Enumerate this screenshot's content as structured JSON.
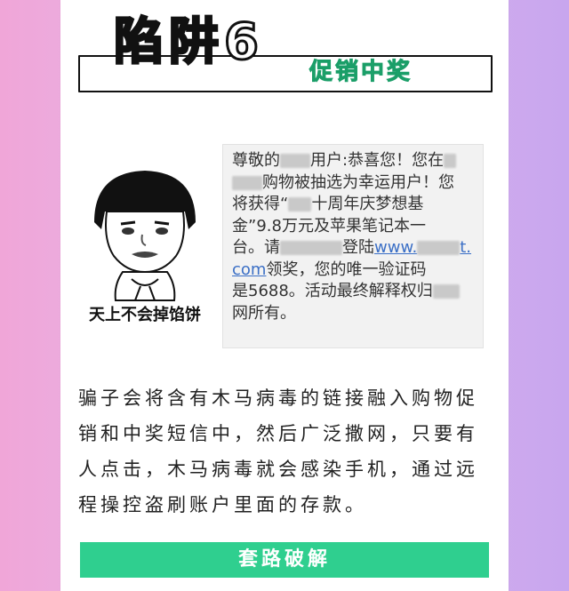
{
  "header": {
    "title": "陷阱6",
    "subtitle": "促销中奖"
  },
  "meme": {
    "caption": "天上不会掉馅饼",
    "icon": "mushroom-hair-meme-face"
  },
  "sms": {
    "line1_a": "尊敬的",
    "line1_b": "用户:恭喜您！您在",
    "line2": "购物被抽选为幸运用户！您",
    "line3_a": "将获得“",
    "line3_b": "十周年庆梦想基",
    "line4": "金”9.8万元及苹果笔记本一",
    "line5_a": "台。请",
    "line5_b": "登陆",
    "link_a": "www.",
    "link_b": "t.",
    "line6_link": "com",
    "line6_b": "领奖，您的唯一验证码",
    "line7": "是5688。活动最终解释权归",
    "line8": "网所有。"
  },
  "body": {
    "paragraph": "骗子会将含有木马病毒的链接融入购物促销和中奖短信中，然后广泛撒网，只要有人点击，木马病毒就会感染手机，通过远程操控盗刷账户里面的存款。"
  },
  "button": {
    "label": "套路破解"
  },
  "colors": {
    "accent": "#2fcf8f",
    "link": "#3b6fc6"
  }
}
